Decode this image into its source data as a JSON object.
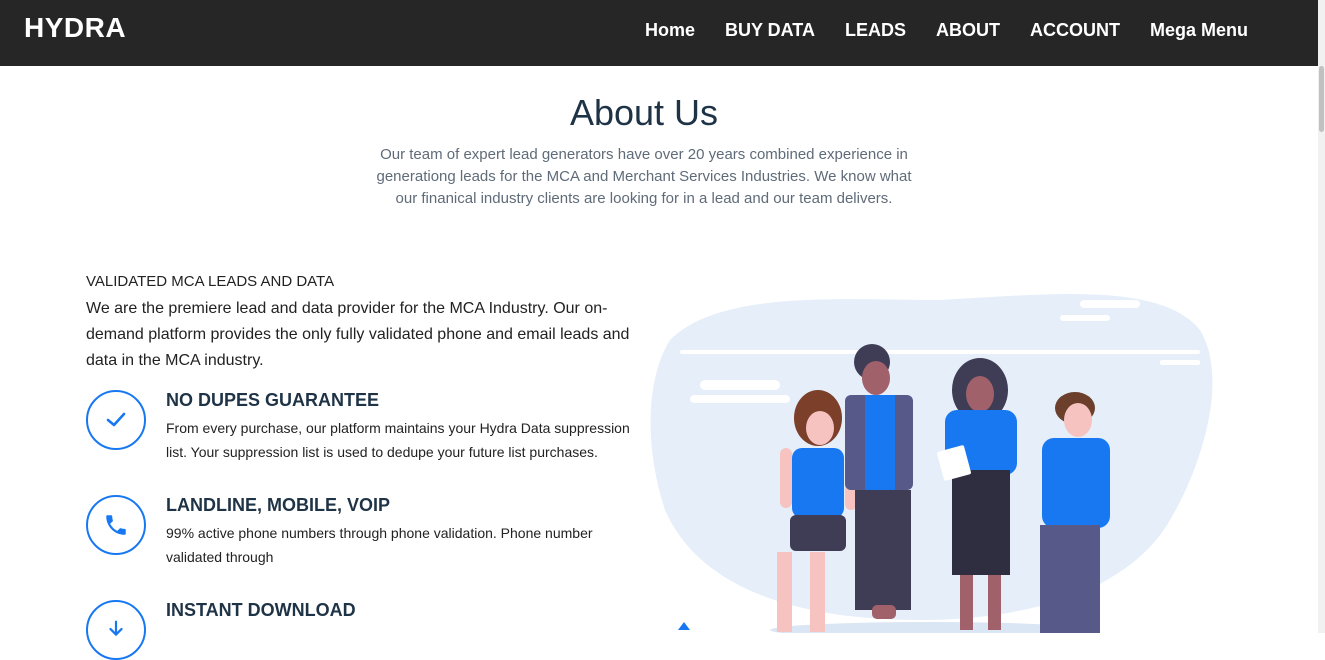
{
  "brand": "HYDRA",
  "nav": [
    "Home",
    "BUY DATA",
    "LEADS",
    "ABOUT",
    "ACCOUNT",
    "Mega Menu"
  ],
  "about": {
    "title": "About Us",
    "description": "Our team of expert lead generators have over 20 years combined experience in generationg leads for the MCA and Merchant Services Industries. We know what our finanical industry clients are looking for in a lead and our team delivers."
  },
  "validated": {
    "heading": "VALIDATED MCA LEADS AND DATA",
    "text": "We are the premiere lead and data provider for the MCA Industry. Our on-demand platform provides the only fully validated phone and email leads and data in the MCA industry."
  },
  "features": [
    {
      "title": "NO DUPES GUARANTEE",
      "text": "From every purchase, our platform maintains your Hydra Data suppression list. Your suppression list is used to dedupe your future list purchases.",
      "icon": "check-icon"
    },
    {
      "title": "LANDLINE, MOBILE, VOIP",
      "text": "99% active phone numbers through phone validation. Phone number validated through",
      "icon": "phone-icon"
    },
    {
      "title": "INSTANT DOWNLOAD",
      "text": "",
      "icon": "download-icon"
    }
  ],
  "colors": {
    "accent": "#1778f2",
    "navbar": "#262626",
    "heading": "#1f3346"
  }
}
